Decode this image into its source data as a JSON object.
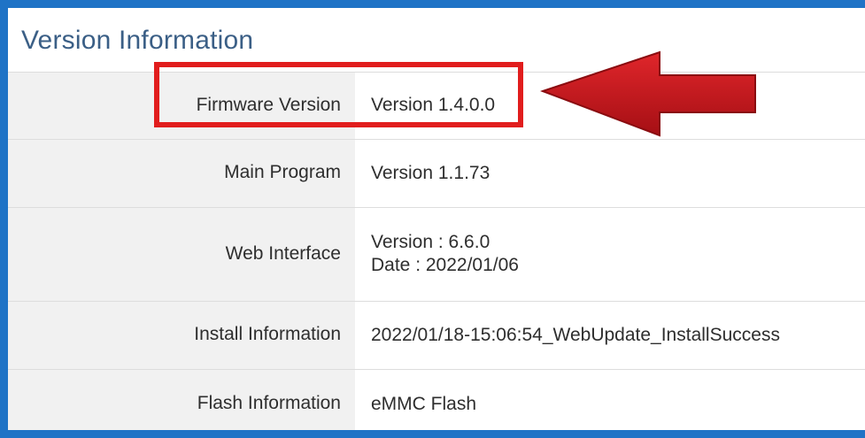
{
  "panel": {
    "title": "Version Information",
    "rows": [
      {
        "label": "Firmware Version",
        "values": [
          "Version 1.4.0.0"
        ]
      },
      {
        "label": "Main Program",
        "values": [
          "Version 1.1.73"
        ]
      },
      {
        "label": "Web Interface",
        "values": [
          "Version : 6.6.0",
          "Date : 2022/01/06"
        ]
      },
      {
        "label": "Install Information",
        "values": [
          "2022/01/18-15:06:54_WebUpdate_InstallSuccess"
        ]
      },
      {
        "label": "Flash Information",
        "values": [
          "eMMC Flash"
        ]
      }
    ]
  },
  "annotation": {
    "highlight_color": "#e11d1d",
    "arrow_color": "#c8161d",
    "highlight_target": "Firmware Version"
  },
  "colors": {
    "frame": "#1f73c6",
    "title": "#3b5f86",
    "label_bg": "#f1f1f1"
  }
}
